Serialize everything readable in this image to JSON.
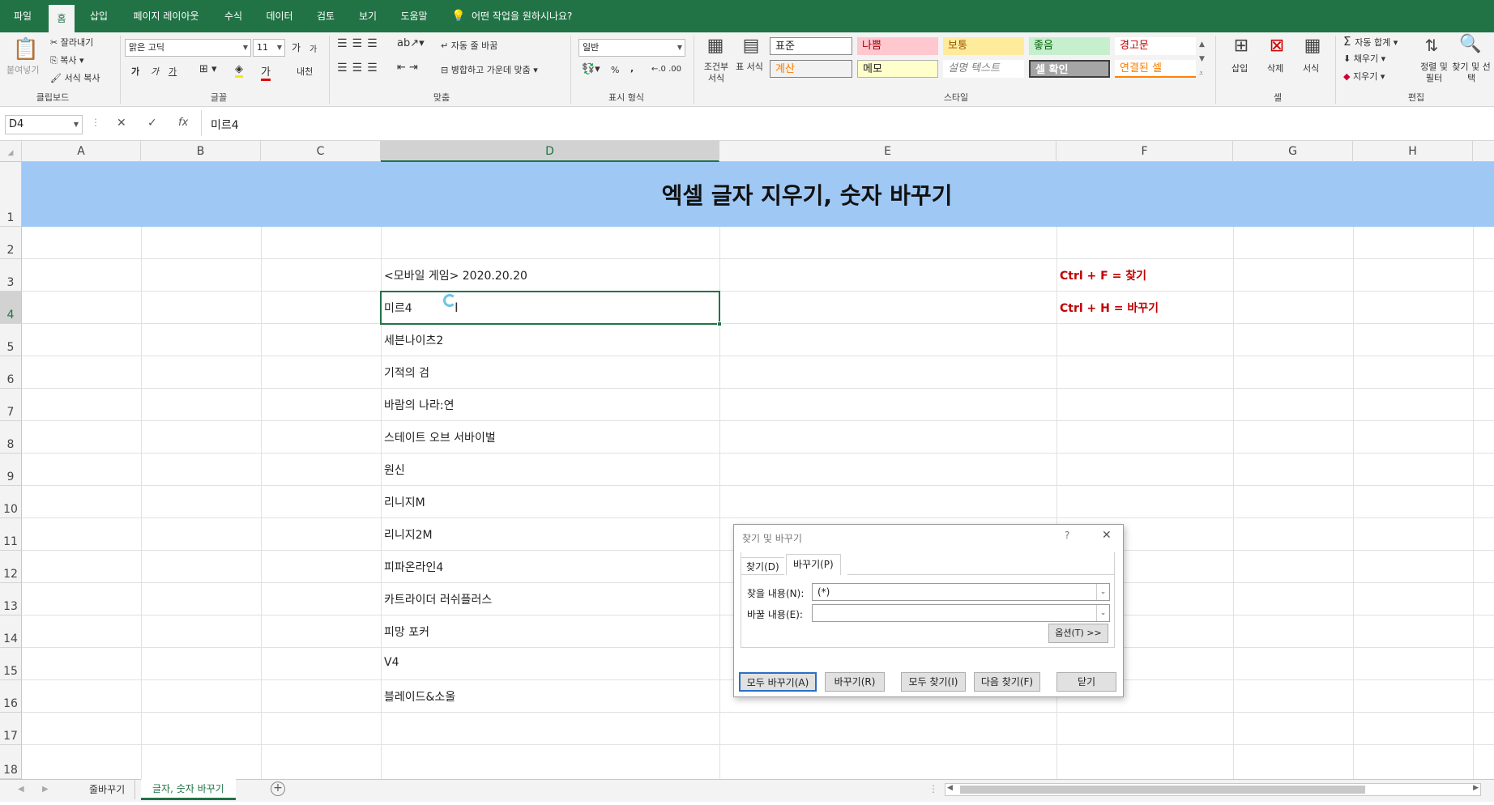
{
  "ribbon_tabs": {
    "file": "파일",
    "home": "홈",
    "insert": "삽입",
    "layout": "페이지 레이아웃",
    "formulas": "수식",
    "data": "데이터",
    "review": "검토",
    "view": "보기",
    "help": "도움말",
    "tell_me": "어떤 작업을 원하시나요?"
  },
  "clipboard": {
    "paste": "붙여넣기",
    "cut": "잘라내기",
    "copy": "복사",
    "format_painter": "서식 복사",
    "label": "클립보드"
  },
  "font": {
    "name": "맑은 고딕",
    "size": "11",
    "grow": "가",
    "shrink": "가",
    "bold": "가",
    "italic": "가",
    "underline": "가",
    "label": "글꼴",
    "phonetic": "내천"
  },
  "alignment": {
    "wrap": "자동 줄 바꿈",
    "merge": "병합하고 가운데 맞춤",
    "label": "맞춤"
  },
  "number": {
    "format": "일반",
    "percent": "%",
    "comma": ",",
    "label": "표시 형식"
  },
  "styles": {
    "conditional": "조건부 서식",
    "table": "표 서식",
    "normal": "표준",
    "bad": "나쁨",
    "neutral": "보통",
    "good": "좋음",
    "warning": "경고문",
    "calculation": "계산",
    "note": "메모",
    "explanatory": "설명 텍스트",
    "check_cell": "셀 확인",
    "linked_cell": "연결된 셀",
    "label": "스타일"
  },
  "cells": {
    "insert": "삽입",
    "delete": "삭제",
    "format": "서식",
    "label": "셀"
  },
  "editing": {
    "autosum": "자동 합계",
    "fill": "채우기",
    "clear": "지우기",
    "sort": "정렬 및 필터",
    "find": "찾기 및 선택",
    "label": "편집"
  },
  "formula_bar": {
    "name_box": "D4",
    "cancel": "✕",
    "enter": "✓",
    "fx": "fx",
    "value": "미르4"
  },
  "columns": [
    "A",
    "B",
    "C",
    "D",
    "E",
    "F",
    "G",
    "H"
  ],
  "rows": [
    "1",
    "2",
    "3",
    "4",
    "5",
    "6",
    "7",
    "8",
    "9",
    "10",
    "11",
    "12",
    "13",
    "14",
    "15",
    "16",
    "17",
    "18"
  ],
  "sheet": {
    "title": "엑셀 글자 지우기, 숫자 바꾸기",
    "d3": "<모바일 게임> 2020.20.20",
    "d_list": [
      "미르4",
      "세븐나이츠2",
      "기적의 검",
      "바람의 나라:연",
      "스테이트 오브 서바이벌",
      "원신",
      "리니지M",
      "리니지2M",
      "피파온라인4",
      "카트라이더 러쉬플러스",
      "피망 포커",
      "V4",
      "블레이드&소울"
    ],
    "f3": "Ctrl + F = 찾기",
    "f4": "Ctrl + H = 바꾸기"
  },
  "dialog": {
    "title": "찾기 및 바꾸기",
    "help": "?",
    "close": "✕",
    "tab_find": "찾기(D)",
    "tab_replace": "바꾸기(P)",
    "find_label": "찾을 내용(N):",
    "find_value": "(*)",
    "replace_label": "바꿀 내용(E):",
    "replace_value": "",
    "options": "옵션(T) >>",
    "replace_all": "모두 바꾸기(A)",
    "replace": "바꾸기(R)",
    "find_all": "모두 찾기(I)",
    "find_next": "다음 찾기(F)",
    "close_btn": "닫기"
  },
  "sheet_tabs": [
    "줄바꾸기",
    "글자, 숫자 바꾸기"
  ],
  "colors": {
    "accent": "#217346",
    "title_fill": "#9fc8f5",
    "shortcut_red": "#c00000"
  }
}
